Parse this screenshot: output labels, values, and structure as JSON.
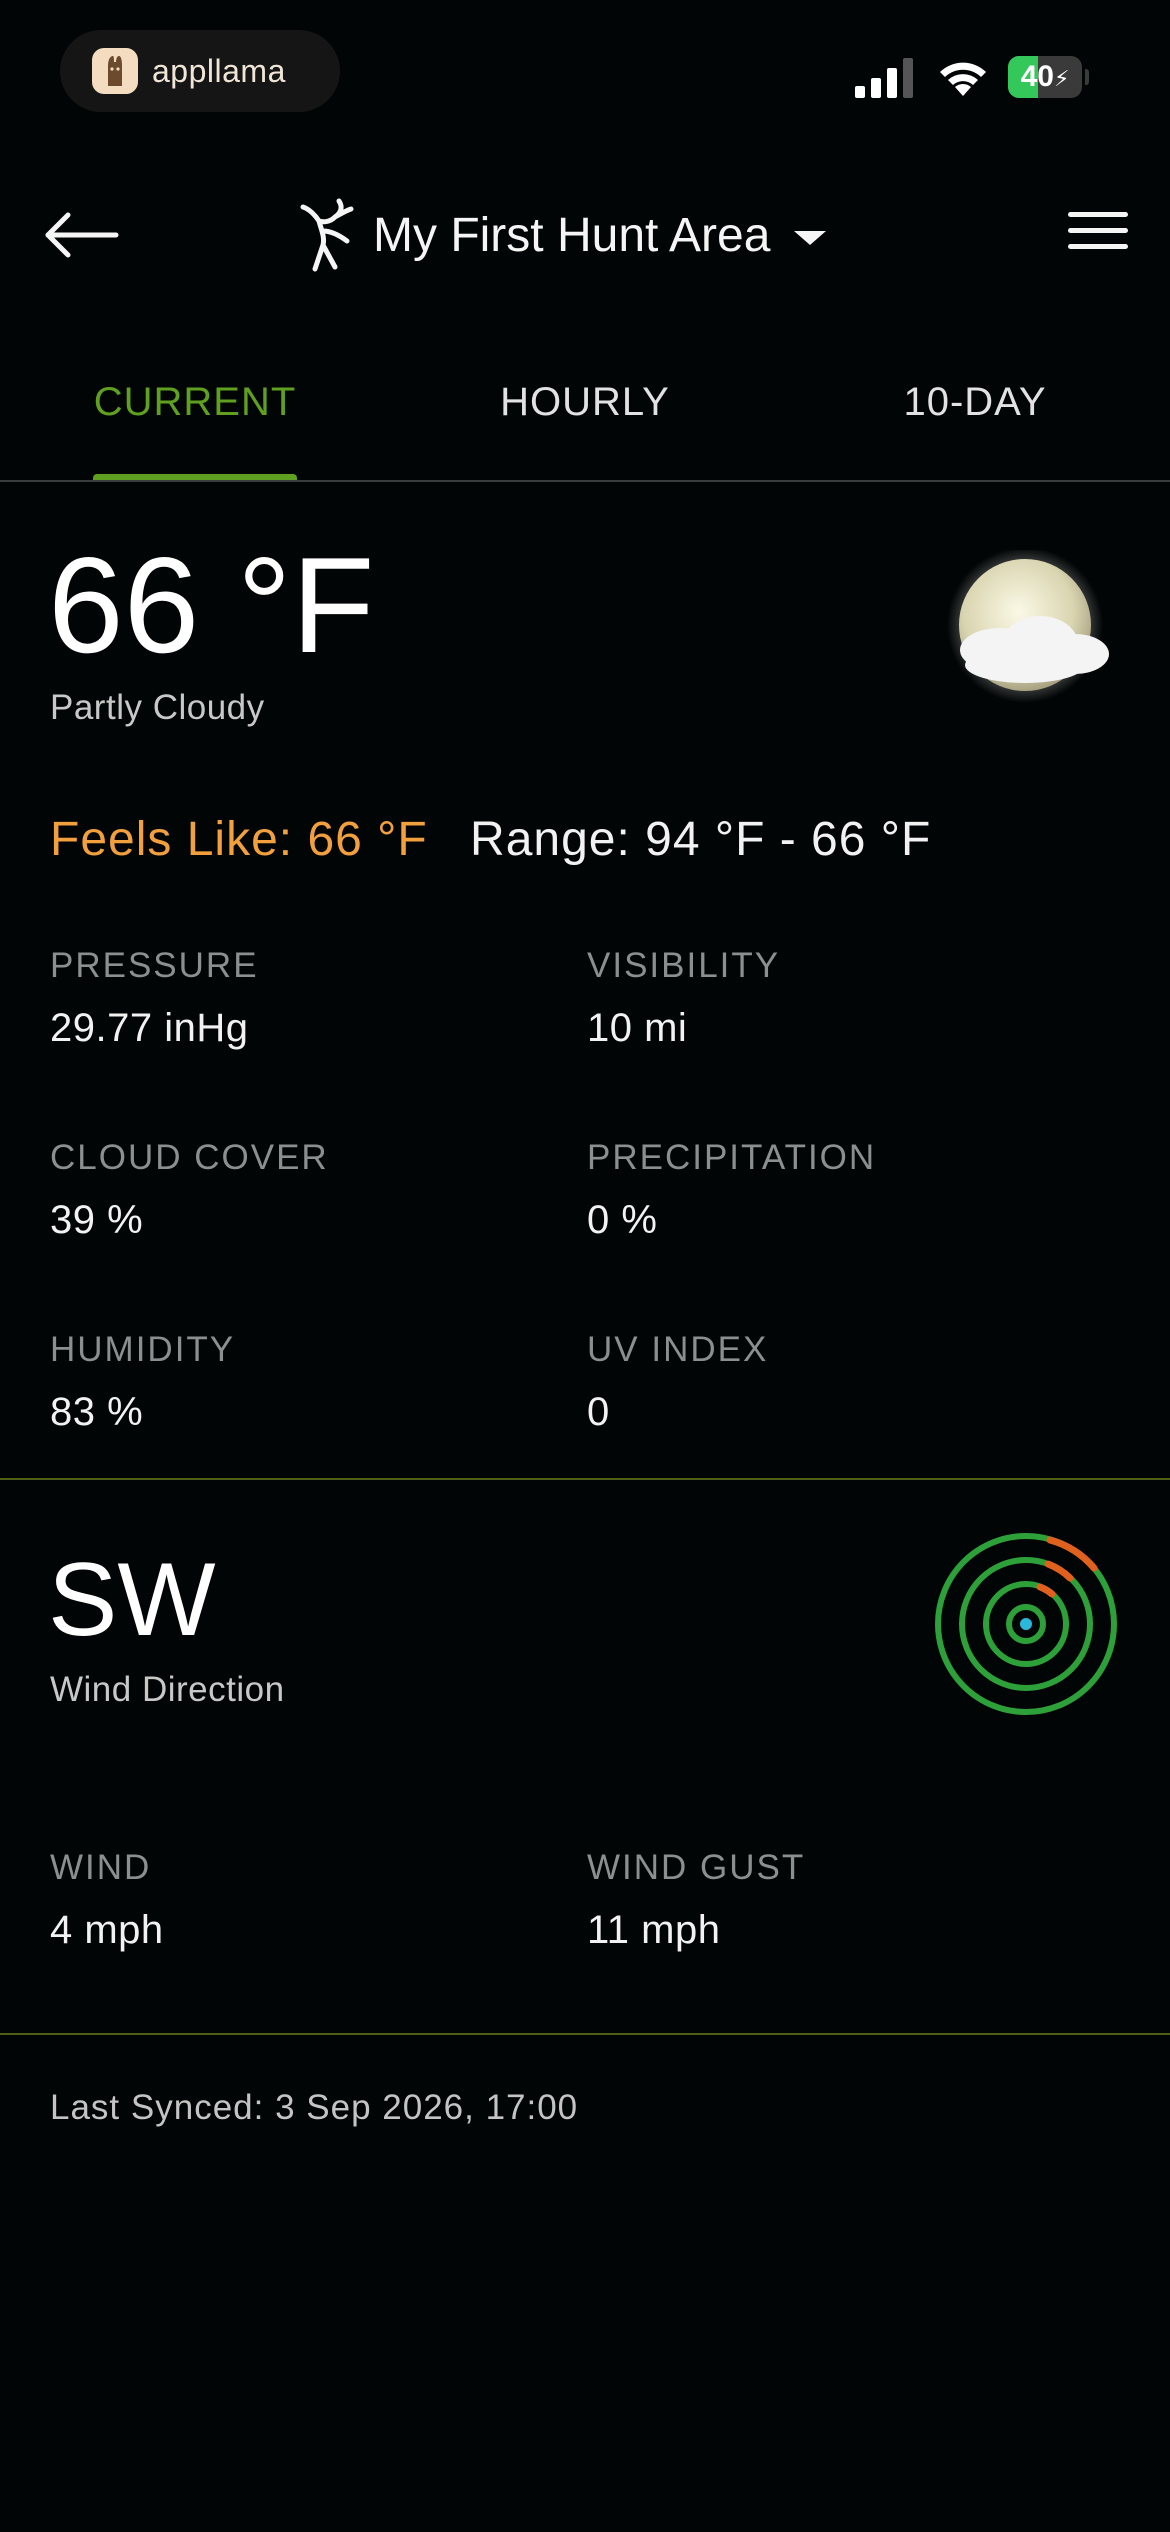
{
  "status_bar": {
    "app_name": "appllama",
    "battery_level": "40",
    "battery_fraction": 0.4,
    "battery_color": "#34c759"
  },
  "nav": {
    "back_icon": "arrow-left-icon",
    "logo_icon": "deer-icon",
    "title": "My First Hunt Area",
    "dropdown_icon": "caret-down-icon",
    "menu_icon": "hamburger-menu-icon"
  },
  "tabs": [
    {
      "label": "CURRENT",
      "active": true
    },
    {
      "label": "HOURLY",
      "active": false
    },
    {
      "label": "10-DAY",
      "active": false
    }
  ],
  "current": {
    "temperature": "66 °F",
    "condition": "Partly Cloudy",
    "condition_icon": "partly-cloudy-night-icon",
    "feels_like": "Feels Like: 66 °F",
    "range": "Range: 94 °F - 66 °F",
    "stats": [
      {
        "label": "PRESSURE",
        "value": "29.77 inHg"
      },
      {
        "label": "VISIBILITY",
        "value": "10 mi"
      },
      {
        "label": "CLOUD COVER",
        "value": "39 %"
      },
      {
        "label": "PRECIPITATION",
        "value": "0 %"
      },
      {
        "label": "HUMIDITY",
        "value": "83 %"
      },
      {
        "label": "UV INDEX",
        "value": "0"
      }
    ]
  },
  "wind": {
    "direction": "SW",
    "direction_label": "Wind Direction",
    "compass_icon": "wind-radar-icon",
    "wind_label": "WIND",
    "wind_value": "4 mph",
    "gust_label": "WIND GUST",
    "gust_value": "11 mph"
  },
  "footer": {
    "last_synced": "Last Synced: 3 Sep 2026, 17:00"
  },
  "colors": {
    "accent": "#5fa021",
    "feels_like": "#f2a03d",
    "background": "#020505",
    "divider": "#4e5f18"
  }
}
